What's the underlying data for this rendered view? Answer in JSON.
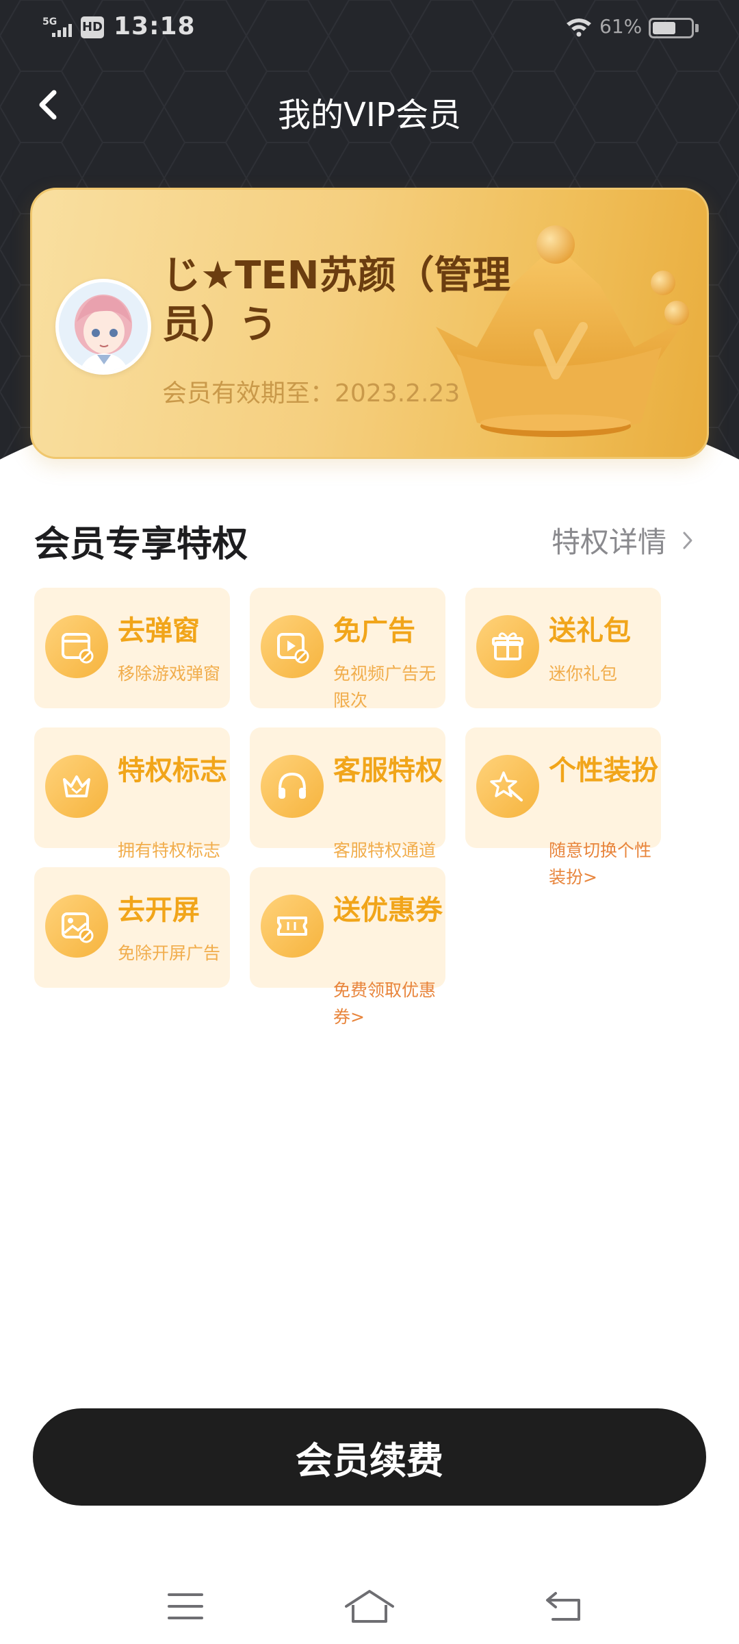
{
  "status_bar": {
    "network": "5G",
    "hd_badge": "HD",
    "time": "13:18",
    "battery_percent": "61%",
    "battery_level": 0.61
  },
  "nav": {
    "back_icon": "chevron-left-icon",
    "title": "我的VIP会员"
  },
  "card": {
    "user_name": "じ★TEN苏颜（管理员）う",
    "expiry_label": "会员有效期至：",
    "expiry_date": "2023.2.23",
    "crown_letter": "V"
  },
  "privileges": {
    "title": "会员专享特权",
    "details_link": "特权详情",
    "items": [
      {
        "title": "去弹窗",
        "desc": "移除游戏弹窗",
        "icon": "popup-window-icon"
      },
      {
        "title": "免广告",
        "desc": "免视频广告无限次",
        "icon": "video-no-ad-icon"
      },
      {
        "title": "送礼包",
        "desc": "迷你礼包",
        "icon": "gift-icon"
      },
      {
        "title": "特权标志",
        "desc": "拥有特权标志",
        "icon": "crown-badge-icon"
      },
      {
        "title": "客服特权",
        "desc": "客服特权通道",
        "icon": "headset-icon"
      },
      {
        "title": "个性装扮",
        "desc": "随意切换个性装扮>",
        "icon": "star-wand-icon"
      },
      {
        "title": "去开屏",
        "desc": "免除开屏广告",
        "icon": "image-splash-icon"
      },
      {
        "title": "送优惠券",
        "desc": "免费领取优惠券>",
        "icon": "coupon-ticket-icon"
      }
    ]
  },
  "renew_button": "会员续费",
  "system_nav": {
    "menu_icon": "menu-icon",
    "home_icon": "home-icon",
    "back_icon": "back-arrow-icon"
  },
  "colors": {
    "header_bg": "#24262b",
    "accent": "#f1a51a",
    "perk_bg": "#fff3df",
    "button_bg": "#1e1e1e"
  }
}
